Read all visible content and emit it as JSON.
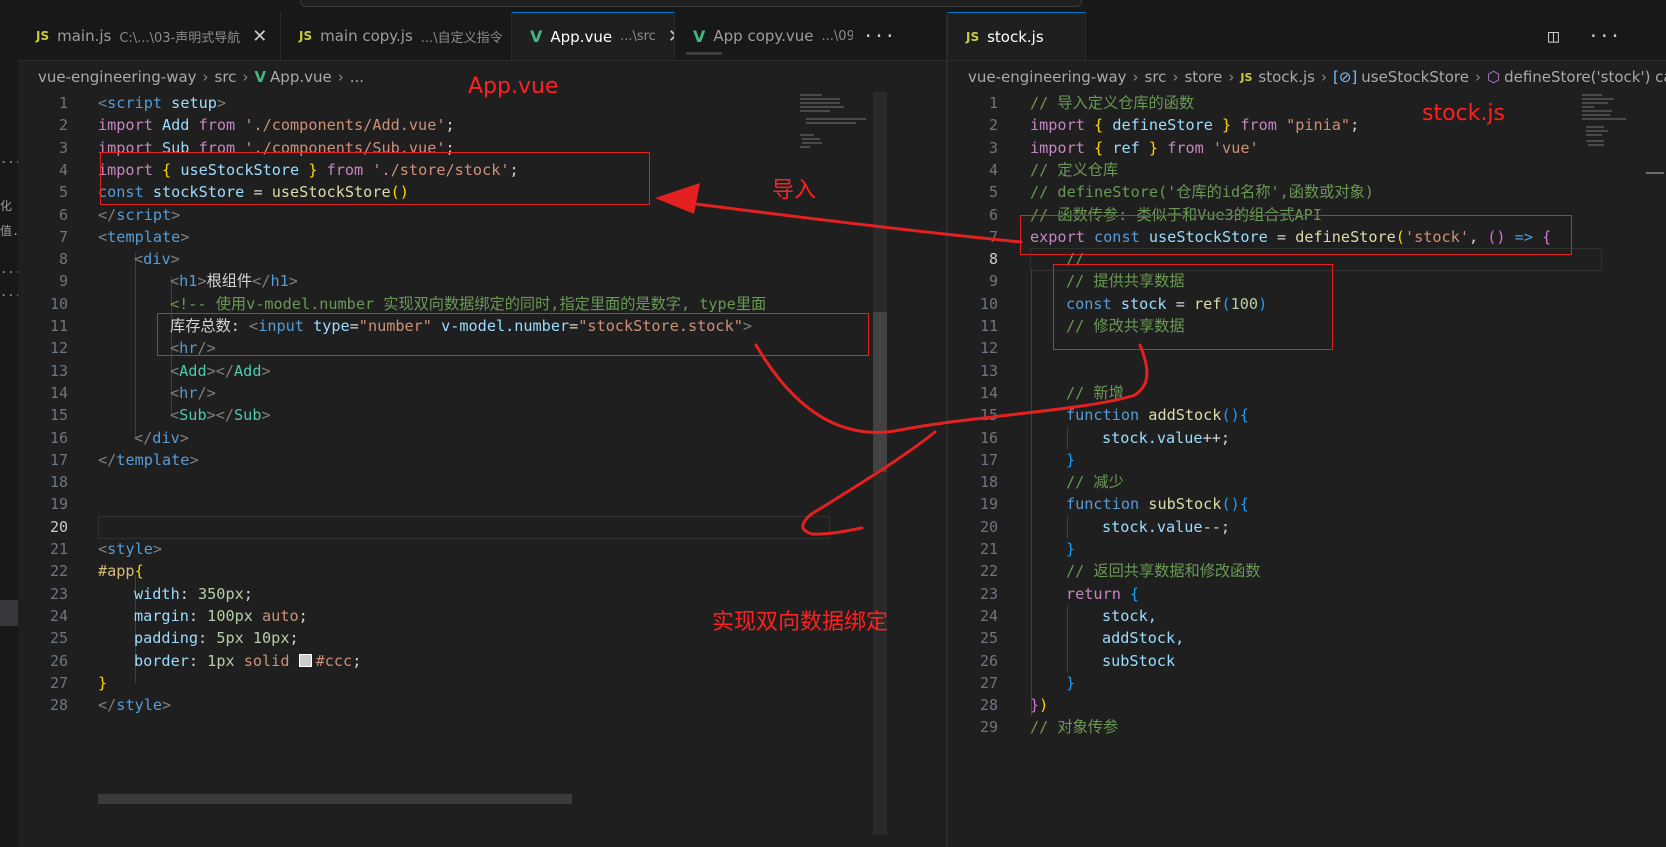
{
  "left": {
    "tabs": [
      {
        "icon": "JS",
        "label": "main.js",
        "path": "C:\\...\\03-声明式导航",
        "active": false
      },
      {
        "icon": "JS",
        "label": "main copy.js",
        "path": "...\\自定义指令",
        "active": false
      },
      {
        "icon": "V",
        "label": "App.vue",
        "path": "...\\src",
        "active": true
      },
      {
        "icon": "V",
        "label": "App copy.vue",
        "path": "...\\09",
        "active": false
      }
    ],
    "more": "···",
    "breadcrumb": [
      "vue-engineering-way",
      "src",
      "App.vue",
      "..."
    ],
    "lines": [
      "1",
      "2",
      "3",
      "4",
      "5",
      "6",
      "7",
      "8",
      "9",
      "10",
      "11",
      "12",
      "13",
      "14",
      "15",
      "16",
      "17",
      "18",
      "19",
      "20",
      "21",
      "22",
      "23",
      "24",
      "25",
      "26",
      "27",
      "28"
    ],
    "current_line": "20",
    "code": {
      "l1a": "<",
      "l1b": "script",
      "l1c": " setup",
      "l1d": ">",
      "l2a": "import",
      "l2b": " Add ",
      "l2c": "from",
      "l2d": " './components/Add.vue'",
      "l2e": ";",
      "l3a": "import",
      "l3b": " Sub ",
      "l3c": "from",
      "l3d": " './components/Sub.vue'",
      "l3e": ";",
      "l4a": "import",
      "l4b": " { ",
      "l4c": "useStockStore",
      "l4d": " } ",
      "l4e": "from",
      "l4f": " './store/stock'",
      "l4g": ";",
      "l5a": "const",
      "l5b": " stockStore",
      "l5c": " = ",
      "l5d": "useStockStore",
      "l5e": "()",
      "l6a": "</",
      "l6b": "script",
      "l6c": ">",
      "l7a": "<",
      "l7b": "template",
      "l7c": ">",
      "l8a": "<",
      "l8b": "div",
      "l8c": ">",
      "l9a": "<",
      "l9b": "h1",
      "l9c": ">",
      "l9d": "根组件",
      "l9e": "</",
      "l9f": "h1",
      "l9g": ">",
      "l10a": "<!-- 使用v-model.number 实现双向数据绑定的同时,指定里面的是数字, type里面",
      "l11a": "库存总数: ",
      "l11b": "<",
      "l11c": "input",
      "l11d": " type",
      "l11e": "=",
      "l11f": "\"number\"",
      "l11g": " v-model.number",
      "l11h": "=",
      "l11i": "\"stockStore.stock\"",
      "l11j": ">",
      "l12a": "<",
      "l12b": "hr",
      "l12c": "/>",
      "l13a": "<",
      "l13b": "Add",
      "l13c": "></",
      "l13d": "Add",
      "l13e": ">",
      "l14a": "<",
      "l14b": "hr",
      "l14c": "/>",
      "l15a": "<",
      "l15b": "Sub",
      "l15c": "></",
      "l15d": "Sub",
      "l15e": ">",
      "l16a": "</",
      "l16b": "div",
      "l16c": ">",
      "l17a": "</",
      "l17b": "template",
      "l17c": ">",
      "l21a": "<",
      "l21b": "style",
      "l21c": ">",
      "l22a": "#app",
      "l22b": "{",
      "l23a": "width",
      "l23b": ": ",
      "l23c": "350px",
      "l23d": ";",
      "l24a": "margin",
      "l24b": ": ",
      "l24c": "100px",
      "l24d": " auto",
      "l24e": ";",
      "l25a": "padding",
      "l25b": ": ",
      "l25c": "5px 10px",
      "l25d": ";",
      "l26a": "border",
      "l26b": ": ",
      "l26c": "1px",
      "l26d": " solid ",
      "l26e": "#ccc",
      "l26f": ";",
      "l27a": "}",
      "l28a": "</",
      "l28b": "style",
      "l28c": ">"
    }
  },
  "right": {
    "tab": {
      "icon": "JS",
      "label": "stock.js",
      "modified": "●"
    },
    "breadcrumb": [
      "vue-engineering-way",
      "src",
      "store",
      "stock.js",
      "useStockStore",
      "defineStore('stock') callback"
    ],
    "lines": [
      "1",
      "2",
      "3",
      "4",
      "5",
      "6",
      "7",
      "8",
      "9",
      "10",
      "11",
      "12",
      "13",
      "14",
      "15",
      "16",
      "17",
      "18",
      "19",
      "20",
      "21",
      "22",
      "23",
      "24",
      "25",
      "26",
      "27",
      "28",
      "29"
    ],
    "current_line": "8",
    "code": {
      "r1": "// 导入定义仓库的函数",
      "r2a": "import",
      "r2b": " { ",
      "r2c": "defineStore",
      "r2d": " } ",
      "r2e": "from",
      "r2f": " \"pinia\"",
      "r2g": ";",
      "r3a": "import",
      "r3b": " { ",
      "r3c": "ref",
      "r3d": " } ",
      "r3e": "from",
      "r3f": " 'vue'",
      "r4": "// 定义仓库",
      "r5": "// defineStore('仓库的id名称',函数或对象)",
      "r6": "// 函数传参: 类似于和Vue3的组合式API",
      "r7a": "export",
      "r7b": " const",
      "r7c": " useStockStore",
      "r7d": " = ",
      "r7e": "defineStore",
      "r7f": "(",
      "r7g": "'stock'",
      "r7h": ", ",
      "r7i": "()",
      "r7j": " => ",
      "r7k": "{",
      "r8": "//",
      "r9": "// 提供共享数据",
      "r10a": "const",
      "r10b": " stock",
      "r10c": " = ",
      "r10d": "ref",
      "r10e": "(",
      "r10f": "100",
      "r10g": ")",
      "r11": "// 修改共享数据",
      "r14": "// 新增",
      "r15a": "function",
      "r15b": " addStock",
      "r15c": "(){",
      "r16a": "stock",
      "r16b": ".value",
      "r16c": "++;",
      "r17": "}",
      "r18": "// 减少",
      "r19a": "function",
      "r19b": " subStock",
      "r19c": "(){",
      "r20a": "stock",
      "r20b": ".value",
      "r20c": "--;",
      "r21": "}",
      "r22": "// 返回共享数据和修改函数",
      "r23a": "return",
      "r23b": " {",
      "r24": "stock,",
      "r25": "addStock,",
      "r26": "subStock",
      "r27": "}",
      "r28a": "}",
      "r28b": ")",
      "r29": "// 对象传参"
    }
  },
  "annotations": {
    "app_vue": "App.vue",
    "stock_js": "stock.js",
    "import": "导入",
    "binding": "实现双向数据绑定"
  },
  "activity_fragments": [
    "...",
    "化",
    "值...",
    "...",
    "..."
  ],
  "colors": {
    "annotation": "#ff2020",
    "background": "#1f1f1f",
    "accent": "#0078d4"
  }
}
